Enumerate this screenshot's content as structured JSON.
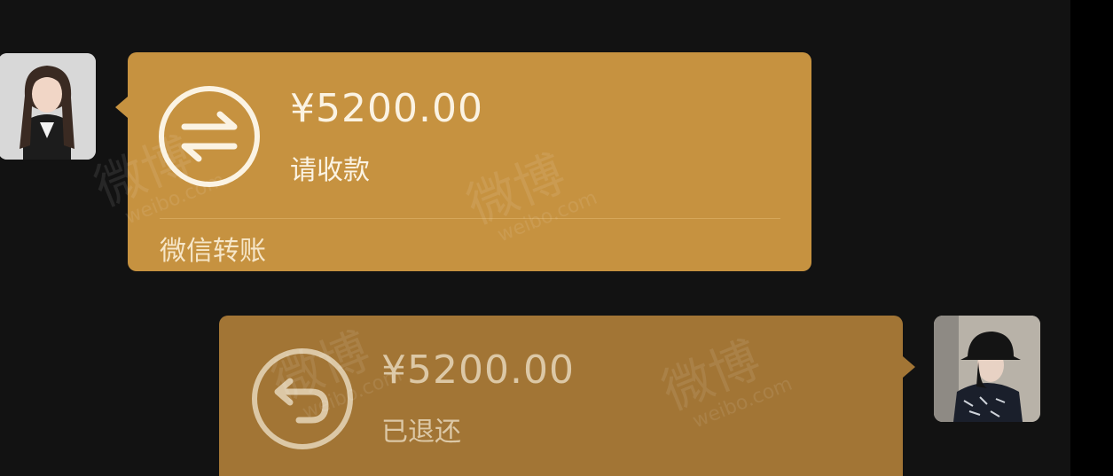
{
  "messages": [
    {
      "side": "left",
      "amount": "¥5200.00",
      "status": "请收款",
      "footer": "微信转账",
      "icon": "transfer-arrows-icon",
      "bubble_color": "#c69240"
    },
    {
      "side": "right",
      "amount": "¥5200.00",
      "status": "已退还",
      "icon": "return-arrow-icon",
      "bubble_color": "#a27535"
    }
  ],
  "watermark": {
    "brand": "微博",
    "domain": "weibo.com"
  }
}
